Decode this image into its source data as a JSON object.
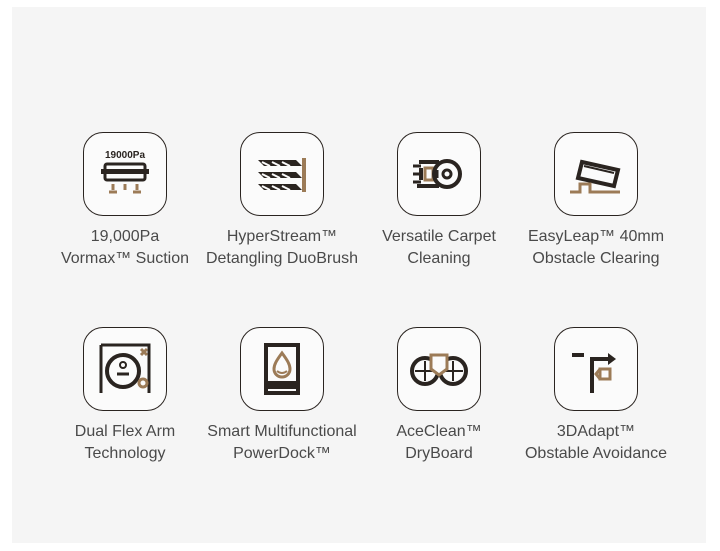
{
  "colors": {
    "dark": "#2a2420",
    "accent": "#9c7b57",
    "text": "#4a4a4a",
    "panel": "#f5f5f5"
  },
  "features": [
    {
      "icon": "robot-suction-icon",
      "badge": "19000Pa",
      "line1": "19,000Pa",
      "line2": "Vormax™ Suction"
    },
    {
      "icon": "duobrush-icon",
      "line1": "HyperStream™",
      "line2": "Detangling DuoBrush"
    },
    {
      "icon": "carpet-brush-icon",
      "line1": "Versatile Carpet",
      "line2": "Cleaning"
    },
    {
      "icon": "obstacle-climb-icon",
      "line1": "EasyLeap™ 40mm",
      "line2": "Obstacle Clearing"
    },
    {
      "icon": "flex-arm-icon",
      "line1": "Dual Flex Arm",
      "line2": "Technology"
    },
    {
      "icon": "powerdock-icon",
      "line1": "Smart Multifunctional",
      "line2": "PowerDock™"
    },
    {
      "icon": "dryboard-icon",
      "line1": "AceClean™",
      "line2": "DryBoard"
    },
    {
      "icon": "3d-adapt-icon",
      "line1": "3DAdapt™",
      "line2": "Obstable Avoidance"
    }
  ]
}
